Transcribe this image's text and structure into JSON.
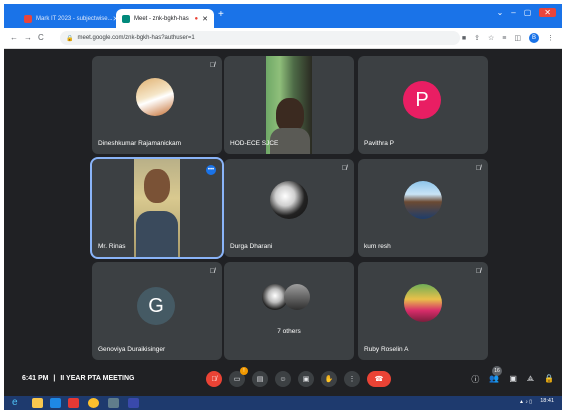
{
  "browser": {
    "tabs": [
      {
        "label": "Mark IT 2023 - subjectwise...",
        "active": false,
        "color": "#e8453c"
      },
      {
        "label": "Meet - znk-bgkh-has",
        "active": true,
        "color": "#00897b"
      }
    ],
    "url": "meet.google.com/znk-bgkh-has?authuser=1",
    "profile_initial": "B",
    "accent": "#1a73e8"
  },
  "participants": [
    {
      "name": "Dineshkumar Rajamanickam",
      "avatar_type": "photo",
      "muted": true
    },
    {
      "name": "HOD-ECE SJCE",
      "avatar_type": "video",
      "muted": false
    },
    {
      "name": "Pavithra P",
      "avatar_type": "letter",
      "letter": "P",
      "color": "#e91e63",
      "muted": false
    },
    {
      "name": "Mr. Rinas",
      "avatar_type": "video",
      "speaking": true
    },
    {
      "name": "Durga Dharani",
      "avatar_type": "photo",
      "muted": true
    },
    {
      "name": "kum resh",
      "avatar_type": "photo",
      "muted": true
    },
    {
      "name": "Genoviya Duraikisinger",
      "avatar_type": "letter",
      "letter": "G",
      "color": "#455a64",
      "muted": true
    },
    {
      "name": "7 others",
      "avatar_type": "group",
      "muted": false
    },
    {
      "name": "Ruby Roselin A",
      "avatar_type": "photo",
      "muted": true
    }
  ],
  "meeting": {
    "time": "6:41 PM",
    "separator": "|",
    "title": "II YEAR PTA MEETING",
    "participant_count": "16"
  },
  "controls": {
    "badge": "!"
  },
  "taskbar": {
    "clock": "18:41"
  }
}
